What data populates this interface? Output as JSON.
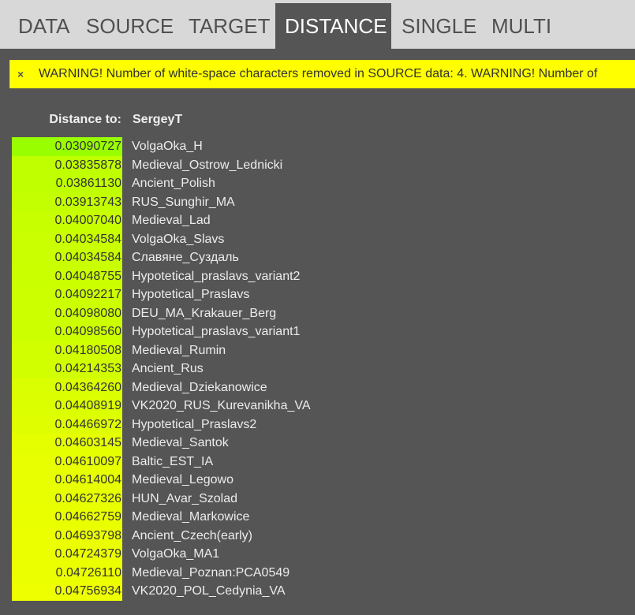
{
  "tabs": [
    {
      "label": "DATA",
      "active": false
    },
    {
      "label": "SOURCE",
      "active": false
    },
    {
      "label": "TARGET",
      "active": false
    },
    {
      "label": "DISTANCE",
      "active": true
    },
    {
      "label": "SINGLE",
      "active": false
    },
    {
      "label": "MULTI",
      "active": false
    }
  ],
  "warning": {
    "close_symbol": "×",
    "message": "WARNING! Number of white-space characters removed in SOURCE data: 4. WARNING! Number of"
  },
  "header": {
    "label": "Distance to:",
    "target": "SergeyT"
  },
  "colors": {
    "best": "#99ff00",
    "worst": "#eeff00",
    "warning_bg": "#ffff00",
    "background": "#555555"
  },
  "results": [
    {
      "distance": "0.03090727",
      "name": "VolgaOka_H"
    },
    {
      "distance": "0.03835878",
      "name": "Medieval_Ostrow_Lednicki"
    },
    {
      "distance": "0.03861130",
      "name": "Ancient_Polish"
    },
    {
      "distance": "0.03913743",
      "name": "RUS_Sunghir_MA"
    },
    {
      "distance": "0.04007040",
      "name": "Medieval_Lad"
    },
    {
      "distance": "0.04034584",
      "name": "VolgaOka_Slavs"
    },
    {
      "distance": "0.04034584",
      "name": "Славяне_Суздаль"
    },
    {
      "distance": "0.04048755",
      "name": "Hypotetical_praslavs_variant2"
    },
    {
      "distance": "0.04092217",
      "name": "Hypotetical_Praslavs"
    },
    {
      "distance": "0.04098080",
      "name": "DEU_MA_Krakauer_Berg"
    },
    {
      "distance": "0.04098560",
      "name": "Hypotetical_praslavs_variant1"
    },
    {
      "distance": "0.04180508",
      "name": "Medieval_Rumin"
    },
    {
      "distance": "0.04214353",
      "name": "Ancient_Rus"
    },
    {
      "distance": "0.04364260",
      "name": "Medieval_Dziekanowice"
    },
    {
      "distance": "0.04408919",
      "name": "VK2020_RUS_Kurevanikha_VA"
    },
    {
      "distance": "0.04466972",
      "name": "Hypotetical_Praslavs2"
    },
    {
      "distance": "0.04603145",
      "name": "Medieval_Santok"
    },
    {
      "distance": "0.04610097",
      "name": "Baltic_EST_IA"
    },
    {
      "distance": "0.04614004",
      "name": "Medieval_Legowo"
    },
    {
      "distance": "0.04627326",
      "name": "HUN_Avar_Szolad"
    },
    {
      "distance": "0.04662759",
      "name": "Medieval_Markowice"
    },
    {
      "distance": "0.04693798",
      "name": "Ancient_Czech(early)"
    },
    {
      "distance": "0.04724379",
      "name": "VolgaOka_MA1"
    },
    {
      "distance": "0.04726110",
      "name": "Medieval_Poznan:PCA0549"
    },
    {
      "distance": "0.04756934",
      "name": "VK2020_POL_Cedynia_VA"
    }
  ]
}
